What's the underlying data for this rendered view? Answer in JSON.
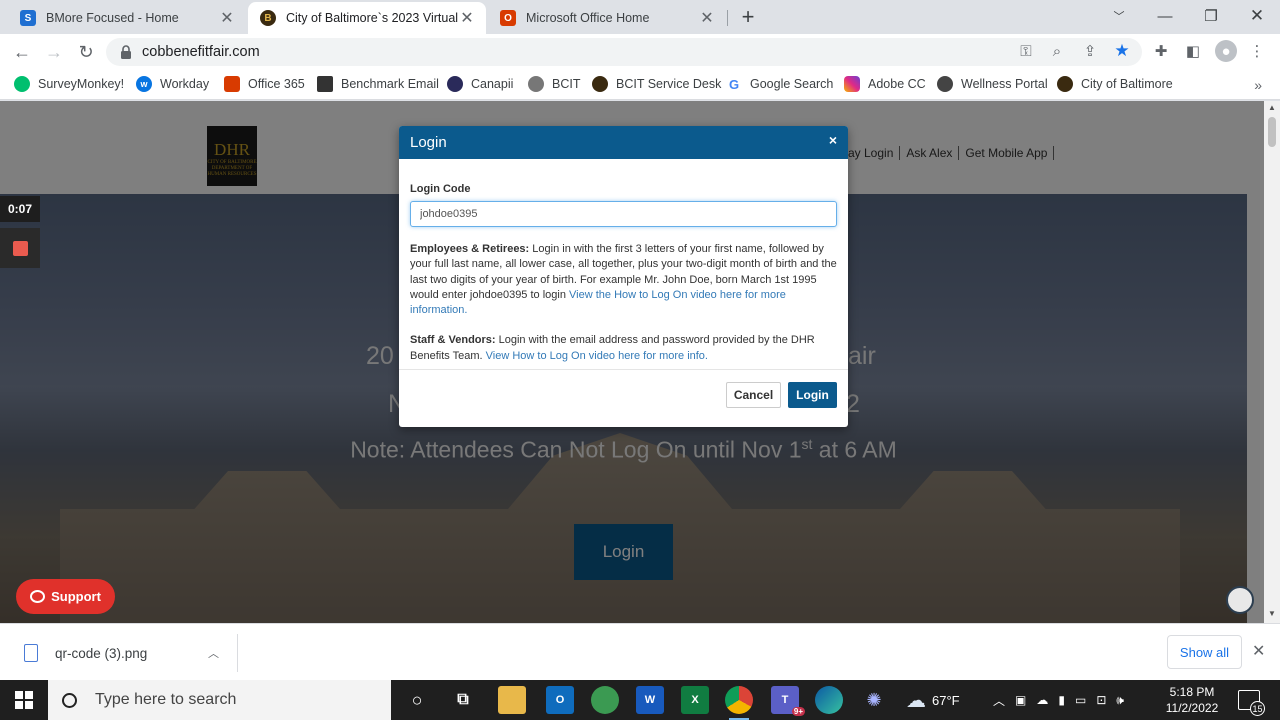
{
  "browser": {
    "tabs": [
      {
        "title": "BMore Focused - Home",
        "favicon": "S",
        "favicon_color": "#1f6fd1"
      },
      {
        "title": "City of Baltimore`s 2023 Virtual C",
        "favicon": "B",
        "favicon_color": "#3a2a10"
      },
      {
        "title": "Microsoft Office Home",
        "favicon": "O",
        "favicon_color": "#d83b01"
      }
    ],
    "url": "cobbenefitfair.com",
    "bookmarks": [
      {
        "label": "SurveyMonkey!",
        "color": "#00bf6f"
      },
      {
        "label": "Workday",
        "color": "#0875e1"
      },
      {
        "label": "Office 365",
        "color": "#d83b01"
      },
      {
        "label": "Benchmark Email",
        "color": "#333333"
      },
      {
        "label": "Canapii",
        "color": "#2a2a5a"
      },
      {
        "label": "BCIT",
        "color": "#777777"
      },
      {
        "label": "BCIT Service Desk",
        "color": "#3a2a10"
      },
      {
        "label": "Google Search",
        "color": "#4285f4"
      },
      {
        "label": "Adobe CC",
        "color": "#da1f26"
      },
      {
        "label": "Wellness Portal",
        "color": "#444444"
      },
      {
        "label": "City of Baltimore",
        "color": "#3a2a10"
      }
    ]
  },
  "site": {
    "logo_text": "DHR",
    "logo_sub": "CITY OF BALTIMORE DEPARTMENT OF HUMAN RESOURCES",
    "nav": [
      "ay Login",
      "Ask Alex",
      "Get Mobile App"
    ],
    "hero_line1_left": "20",
    "hero_line1_right": "air",
    "hero_line2_left": "N",
    "hero_line2_right": "2",
    "hero_note": "Note: Attendees Can Not Log On until Nov 1",
    "hero_note_sup": "st",
    "hero_note_end": " at 6 AM",
    "login_button": "Login",
    "support_label": "Support"
  },
  "recorder": {
    "time": "0:07"
  },
  "modal": {
    "title": "Login",
    "close": "×",
    "code_label": "Login Code",
    "code_value": "johdoe0395",
    "employees_heading": "Employees & Retirees:",
    "employees_text": " Login in with the first 3 letters of your first name, followed by your full last name, all lower case, all together, plus your two-digit month of birth and the last two digits of your year of birth. For example Mr. John Doe, born March 1st 1995 would enter johdoe0395 to login ",
    "employees_link": "View the How to Log On video here for more information.",
    "staff_heading": "Staff & Vendors:",
    "staff_text": " Login with the email address and password provided by the DHR Benefits Team. ",
    "staff_link": "View How to Log On video here for more info.",
    "cancel": "Cancel",
    "login": "Login"
  },
  "downloads": {
    "file": "qr-code (3).png",
    "show_all": "Show all"
  },
  "taskbar": {
    "search_placeholder": "Type here to search",
    "weather": "67°F",
    "time": "5:18 PM",
    "date": "11/2/2022",
    "notifications": "15",
    "teams_badge": "9+"
  }
}
